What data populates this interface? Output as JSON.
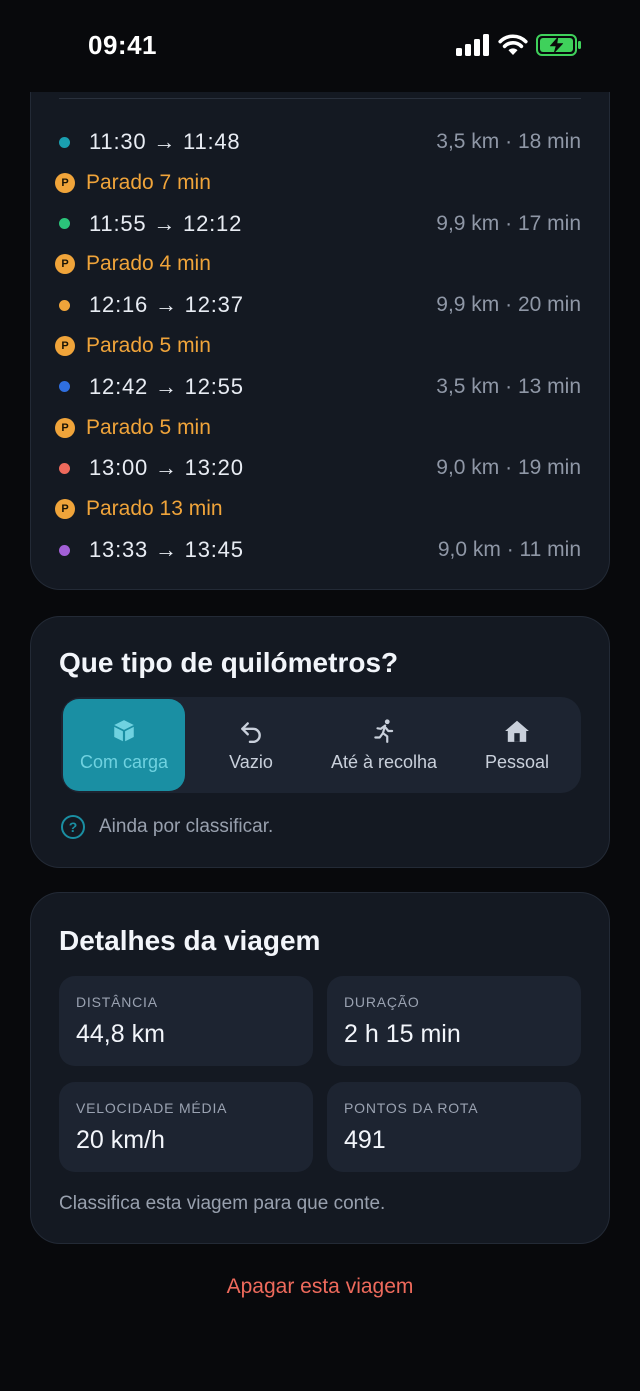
{
  "status": {
    "time": "09:41"
  },
  "trip": {
    "rows": [
      {
        "kind": "segment",
        "time": "11:30 → 11:48",
        "info": "3,5 km · 18 min",
        "color": "#1a9fb0"
      },
      {
        "kind": "stop",
        "badge": "P",
        "text": "Parado 7 min"
      },
      {
        "kind": "segment",
        "time": "11:55 → 12:12",
        "info": "9,9 km · 17 min",
        "color": "#2bc47a"
      },
      {
        "kind": "stop",
        "badge": "P",
        "text": "Parado 4 min"
      },
      {
        "kind": "segment",
        "time": "12:16 → 12:37",
        "info": "9,9 km · 20 min",
        "color": "#f0a43a"
      },
      {
        "kind": "stop",
        "badge": "P",
        "text": "Parado 5 min"
      },
      {
        "kind": "segment",
        "time": "12:42 → 12:55",
        "info": "3,5 km · 13 min",
        "color": "#2f6fe0"
      },
      {
        "kind": "stop",
        "badge": "P",
        "text": "Parado 5 min"
      },
      {
        "kind": "segment",
        "time": "13:00 → 13:20",
        "info": "9,0 km · 19 min",
        "color": "#ee6a5c"
      },
      {
        "kind": "stop",
        "badge": "P",
        "text": "Parado 13 min"
      },
      {
        "kind": "segment",
        "time": "13:33 → 13:45",
        "info": "9,0 km · 11 min",
        "color": "#a25fd6"
      }
    ]
  },
  "km_type": {
    "title": "Que tipo de quilómetros?",
    "options": [
      {
        "label": "Com carga",
        "icon": "box-icon",
        "selected": true
      },
      {
        "label": "Vazio",
        "icon": "return-arrow-icon",
        "selected": false
      },
      {
        "label": "Até à recolha",
        "icon": "running-person-icon",
        "selected": false
      },
      {
        "label": "Pessoal",
        "icon": "home-icon",
        "selected": false
      }
    ],
    "hint_icon": "?",
    "hint": "Ainda por classificar."
  },
  "details": {
    "title": "Detalhes da viagem",
    "stats": [
      {
        "label": "DISTÂNCIA",
        "value": "44,8 km"
      },
      {
        "label": "DURAÇÃO",
        "value": "2 h 15 min"
      },
      {
        "label": "VELOCIDADE MÉDIA",
        "value": "20 km/h"
      },
      {
        "label": "PONTOS DA ROTA",
        "value": "491"
      }
    ],
    "note": "Classifica esta viagem para que conte."
  },
  "delete_label": "Apagar esta viagem",
  "colors": {
    "accent": "#1a8fa3",
    "stop": "#f0a43a",
    "danger": "#ee6a5c"
  }
}
